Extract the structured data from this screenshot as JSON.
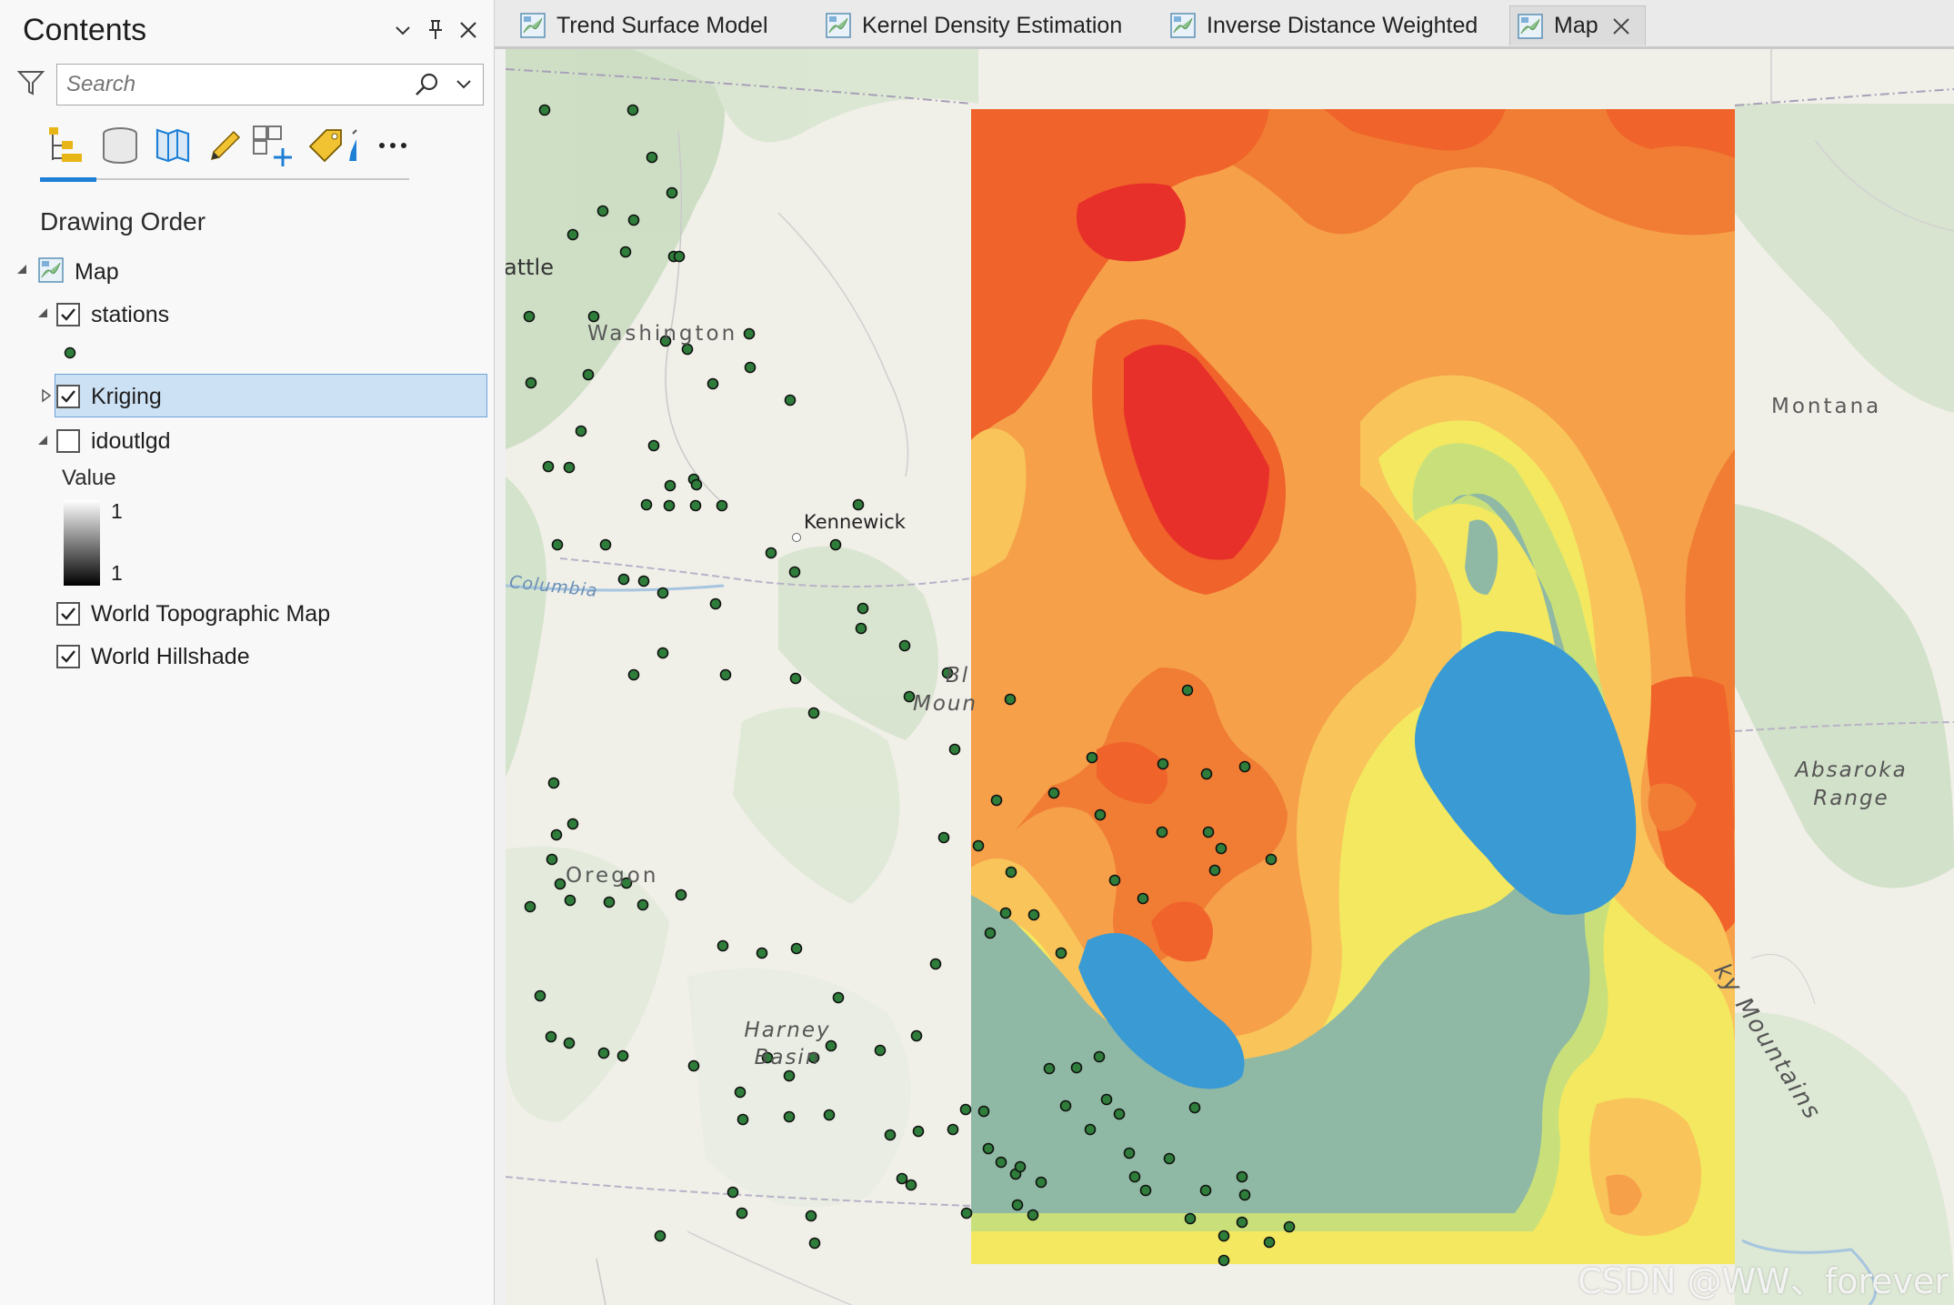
{
  "contents": {
    "title": "Contents",
    "search_placeholder": "Search",
    "section_title": "Drawing Order",
    "layers": {
      "map": "Map",
      "stations": "stations",
      "kriging": "Kriging",
      "idoutlgd": "idoutlgd",
      "legend_title": "Value",
      "legend_high": "1",
      "legend_low": "1",
      "topo": "World Topographic Map",
      "hillshade": "World Hillshade"
    },
    "checked": {
      "stations": true,
      "kriging": true,
      "idoutlgd": false,
      "topo": true,
      "hillshade": true
    }
  },
  "tabs": [
    {
      "label": "Trend Surface Model"
    },
    {
      "label": "Kernel Density Estimation"
    },
    {
      "label": "Inverse Distance Weighted"
    },
    {
      "label": "Map"
    }
  ],
  "map": {
    "labels": {
      "seattle": "attle",
      "washington": "Washington",
      "kennewick": "Kennewick",
      "columbia": "Columbia",
      "montana": "Montana",
      "blue_mtns_1": "Bl",
      "blue_mtns_2": "Moun",
      "oregon": "Oregon",
      "harney_1": "Harney",
      "harney_2": "Basin",
      "absaroka_1": "Absaroka",
      "absaroka_2": "Range",
      "rocky": "ky Mountains"
    },
    "watermark": "CSDN @WW、forever",
    "colors": {
      "red": "#e8302a",
      "orange_red": "#f05a28",
      "orange": "#f6a04a",
      "light_orange": "#f9c45a",
      "yellow": "#f3e860",
      "light_green": "#c9e07a",
      "sage": "#8fb9a4",
      "blue": "#3a9ad4",
      "station_fill": "#2f7d3a"
    }
  }
}
